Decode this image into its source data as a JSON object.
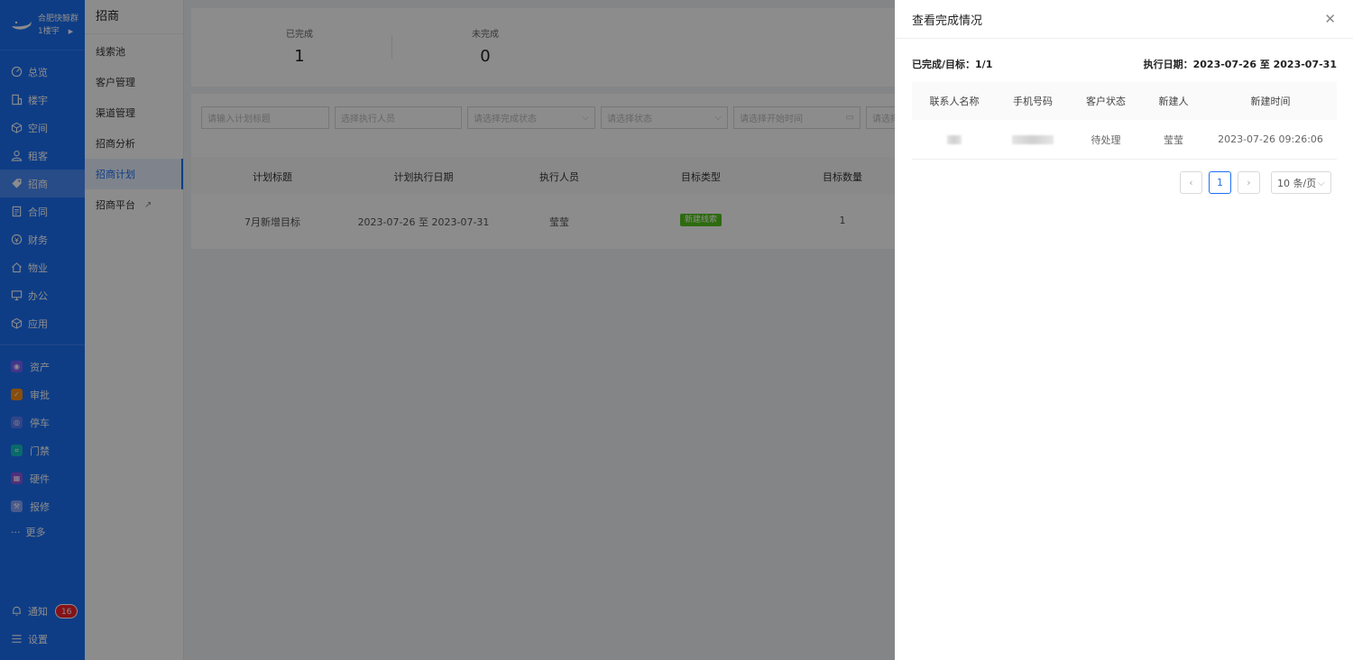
{
  "brand": {
    "name": "合肥快鲸群",
    "building": "1楼宇"
  },
  "nav": {
    "items": [
      {
        "label": "总览",
        "icon": "dashboard-icon"
      },
      {
        "label": "楼宇",
        "icon": "building-icon"
      },
      {
        "label": "空间",
        "icon": "cube-icon"
      },
      {
        "label": "租客",
        "icon": "users-icon"
      },
      {
        "label": "招商",
        "icon": "tag-icon"
      },
      {
        "label": "合同",
        "icon": "document-icon"
      },
      {
        "label": "财务",
        "icon": "coin-icon"
      },
      {
        "label": "物业",
        "icon": "home-icon"
      },
      {
        "label": "办公",
        "icon": "monitor-icon"
      },
      {
        "label": "应用",
        "icon": "box-icon"
      }
    ],
    "apps": [
      {
        "label": "资产",
        "color": "#7b61ff"
      },
      {
        "label": "审批",
        "color": "#fa8c16"
      },
      {
        "label": "停车",
        "color": "#597ef7"
      },
      {
        "label": "门禁",
        "color": "#13c2c2"
      },
      {
        "label": "硬件",
        "color": "#9254de"
      },
      {
        "label": "报修",
        "color": "#85a5ff"
      }
    ],
    "more": "更多",
    "notice": {
      "label": "通知",
      "count": "16"
    },
    "settings": "设置"
  },
  "submenu": {
    "title": "招商",
    "items": [
      "线索池",
      "客户管理",
      "渠道管理",
      "招商分析",
      "招商计划",
      "招商平台"
    ]
  },
  "stats": {
    "done_label": "已完成",
    "done_value": "1",
    "undone_label": "未完成",
    "undone_value": "0"
  },
  "filters": {
    "title_ph": "请输入计划标题",
    "executor_ph": "选择执行人员",
    "completion_ph": "请选择完成状态",
    "status_ph": "请选择状态",
    "start_ph": "请选择开始时间",
    "end_ph": "请选择"
  },
  "plan_table": {
    "headers": [
      "计划标题",
      "计划执行日期",
      "执行人员",
      "目标类型",
      "目标数量"
    ],
    "row": {
      "title": "7月新增目标",
      "date": "2023-07-26 至 2023-07-31",
      "executor": "莹莹",
      "type": "新建线索",
      "count": "1"
    }
  },
  "drawer": {
    "title": "查看完成情况",
    "progress": "已完成/目标：1/1",
    "period": "执行日期：2023-07-26 至 2023-07-31",
    "headers": [
      "联系人名称",
      "手机号码",
      "客户状态",
      "新建人",
      "新建时间"
    ],
    "row": {
      "status": "待处理",
      "creator": "莹莹",
      "created": "2023-07-26 09:26:06"
    },
    "pagination": {
      "current": "1",
      "size": "10 条/页"
    }
  }
}
